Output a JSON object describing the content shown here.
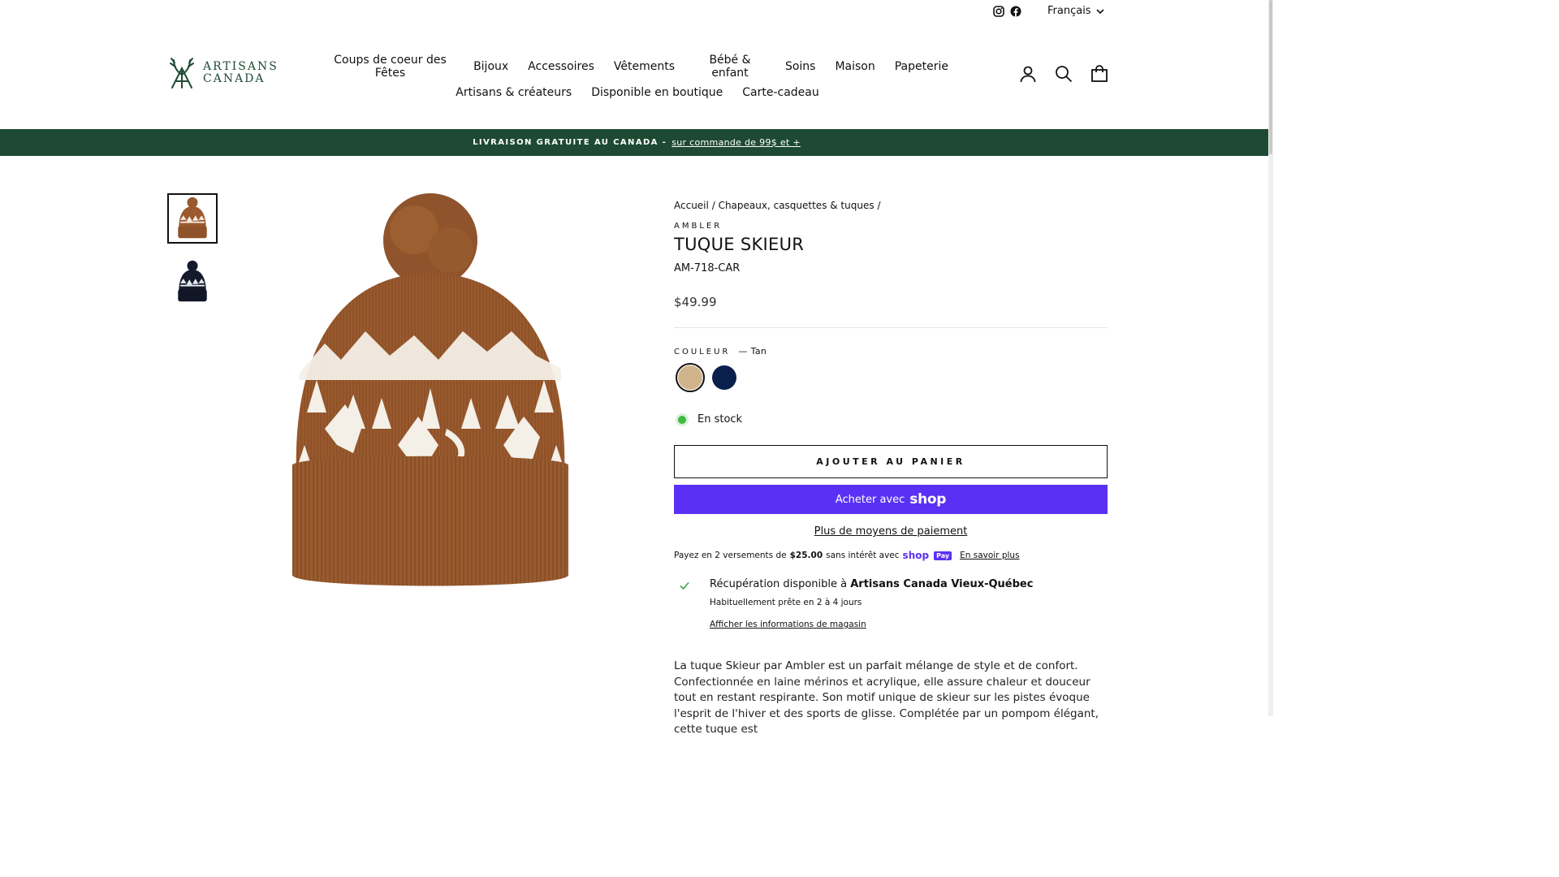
{
  "utility": {
    "language": "Français",
    "social_icons": [
      "instagram-icon",
      "facebook-icon"
    ]
  },
  "logo": {
    "line1": "ARTISANS",
    "line2": "CANADA"
  },
  "nav": {
    "row1": [
      "Coups de coeur des Fêtes",
      "Bijoux",
      "Accessoires",
      "Vêtements",
      "Bébé & enfant",
      "Soins",
      "Maison",
      "Papeterie"
    ],
    "row2": [
      "Artisans & créateurs",
      "Disponible en boutique",
      "Carte-cadeau"
    ]
  },
  "header_icons": [
    "account-icon",
    "search-icon",
    "cart-icon"
  ],
  "announcement": {
    "text": "LIVRAISON GRATUITE AU CANADA -",
    "link": "sur commande de 99$ et +"
  },
  "breadcrumb": {
    "items": [
      "Accueil",
      "Chapeaux, casquettes & tuques"
    ],
    "separator": "/"
  },
  "product": {
    "vendor": "AMBLER",
    "title": "TUQUE SKIEUR",
    "sku": "AM-718-CAR",
    "price": "$49.99",
    "color_label": "COULEUR",
    "color_value": "— Tan",
    "swatches": [
      {
        "name": "Tan",
        "color": "#d2b48c",
        "selected": true
      },
      {
        "name": "Navy",
        "color": "#0b1f4d",
        "selected": false
      }
    ],
    "stock": "En stock",
    "add_to_cart": "AJOUTER AU PANIER",
    "shop_pay_prefix": "Acheter avec",
    "shop_pay_word": "shop",
    "more_payment": "Plus de moyens de paiement",
    "installments": {
      "prefix": "Payez en 2 versements de",
      "amount": "$25.00",
      "suffix": "sans intérêt avec",
      "brand_word": "shop",
      "brand_badge": "Pay",
      "link": "En savoir plus"
    },
    "pickup": {
      "prefix": "Récupération disponible à",
      "store": "Artisans Canada Vieux-Québec",
      "sub": "Habituellement prête en 2 à 4 jours",
      "link": "Afficher les informations de magasin"
    },
    "description": "La tuque Skieur par Ambler est un parfait mélange de style et de confort. Confectionnée en laine mérinos et acrylique, elle assure chaleur et douceur tout en restant respirante. Son motif unique de skieur sur les pistes évoque l'esprit de l'hiver et des sports de glisse. Complétée par un pompom élégant, cette tuque est"
  },
  "colors": {
    "brand_green": "#1e4a34",
    "shop_purple": "#5a31f4",
    "beanie_brown": "#9a5a2e",
    "beanie_navy": "#141a2c",
    "stock_green": "#3fba3f"
  }
}
